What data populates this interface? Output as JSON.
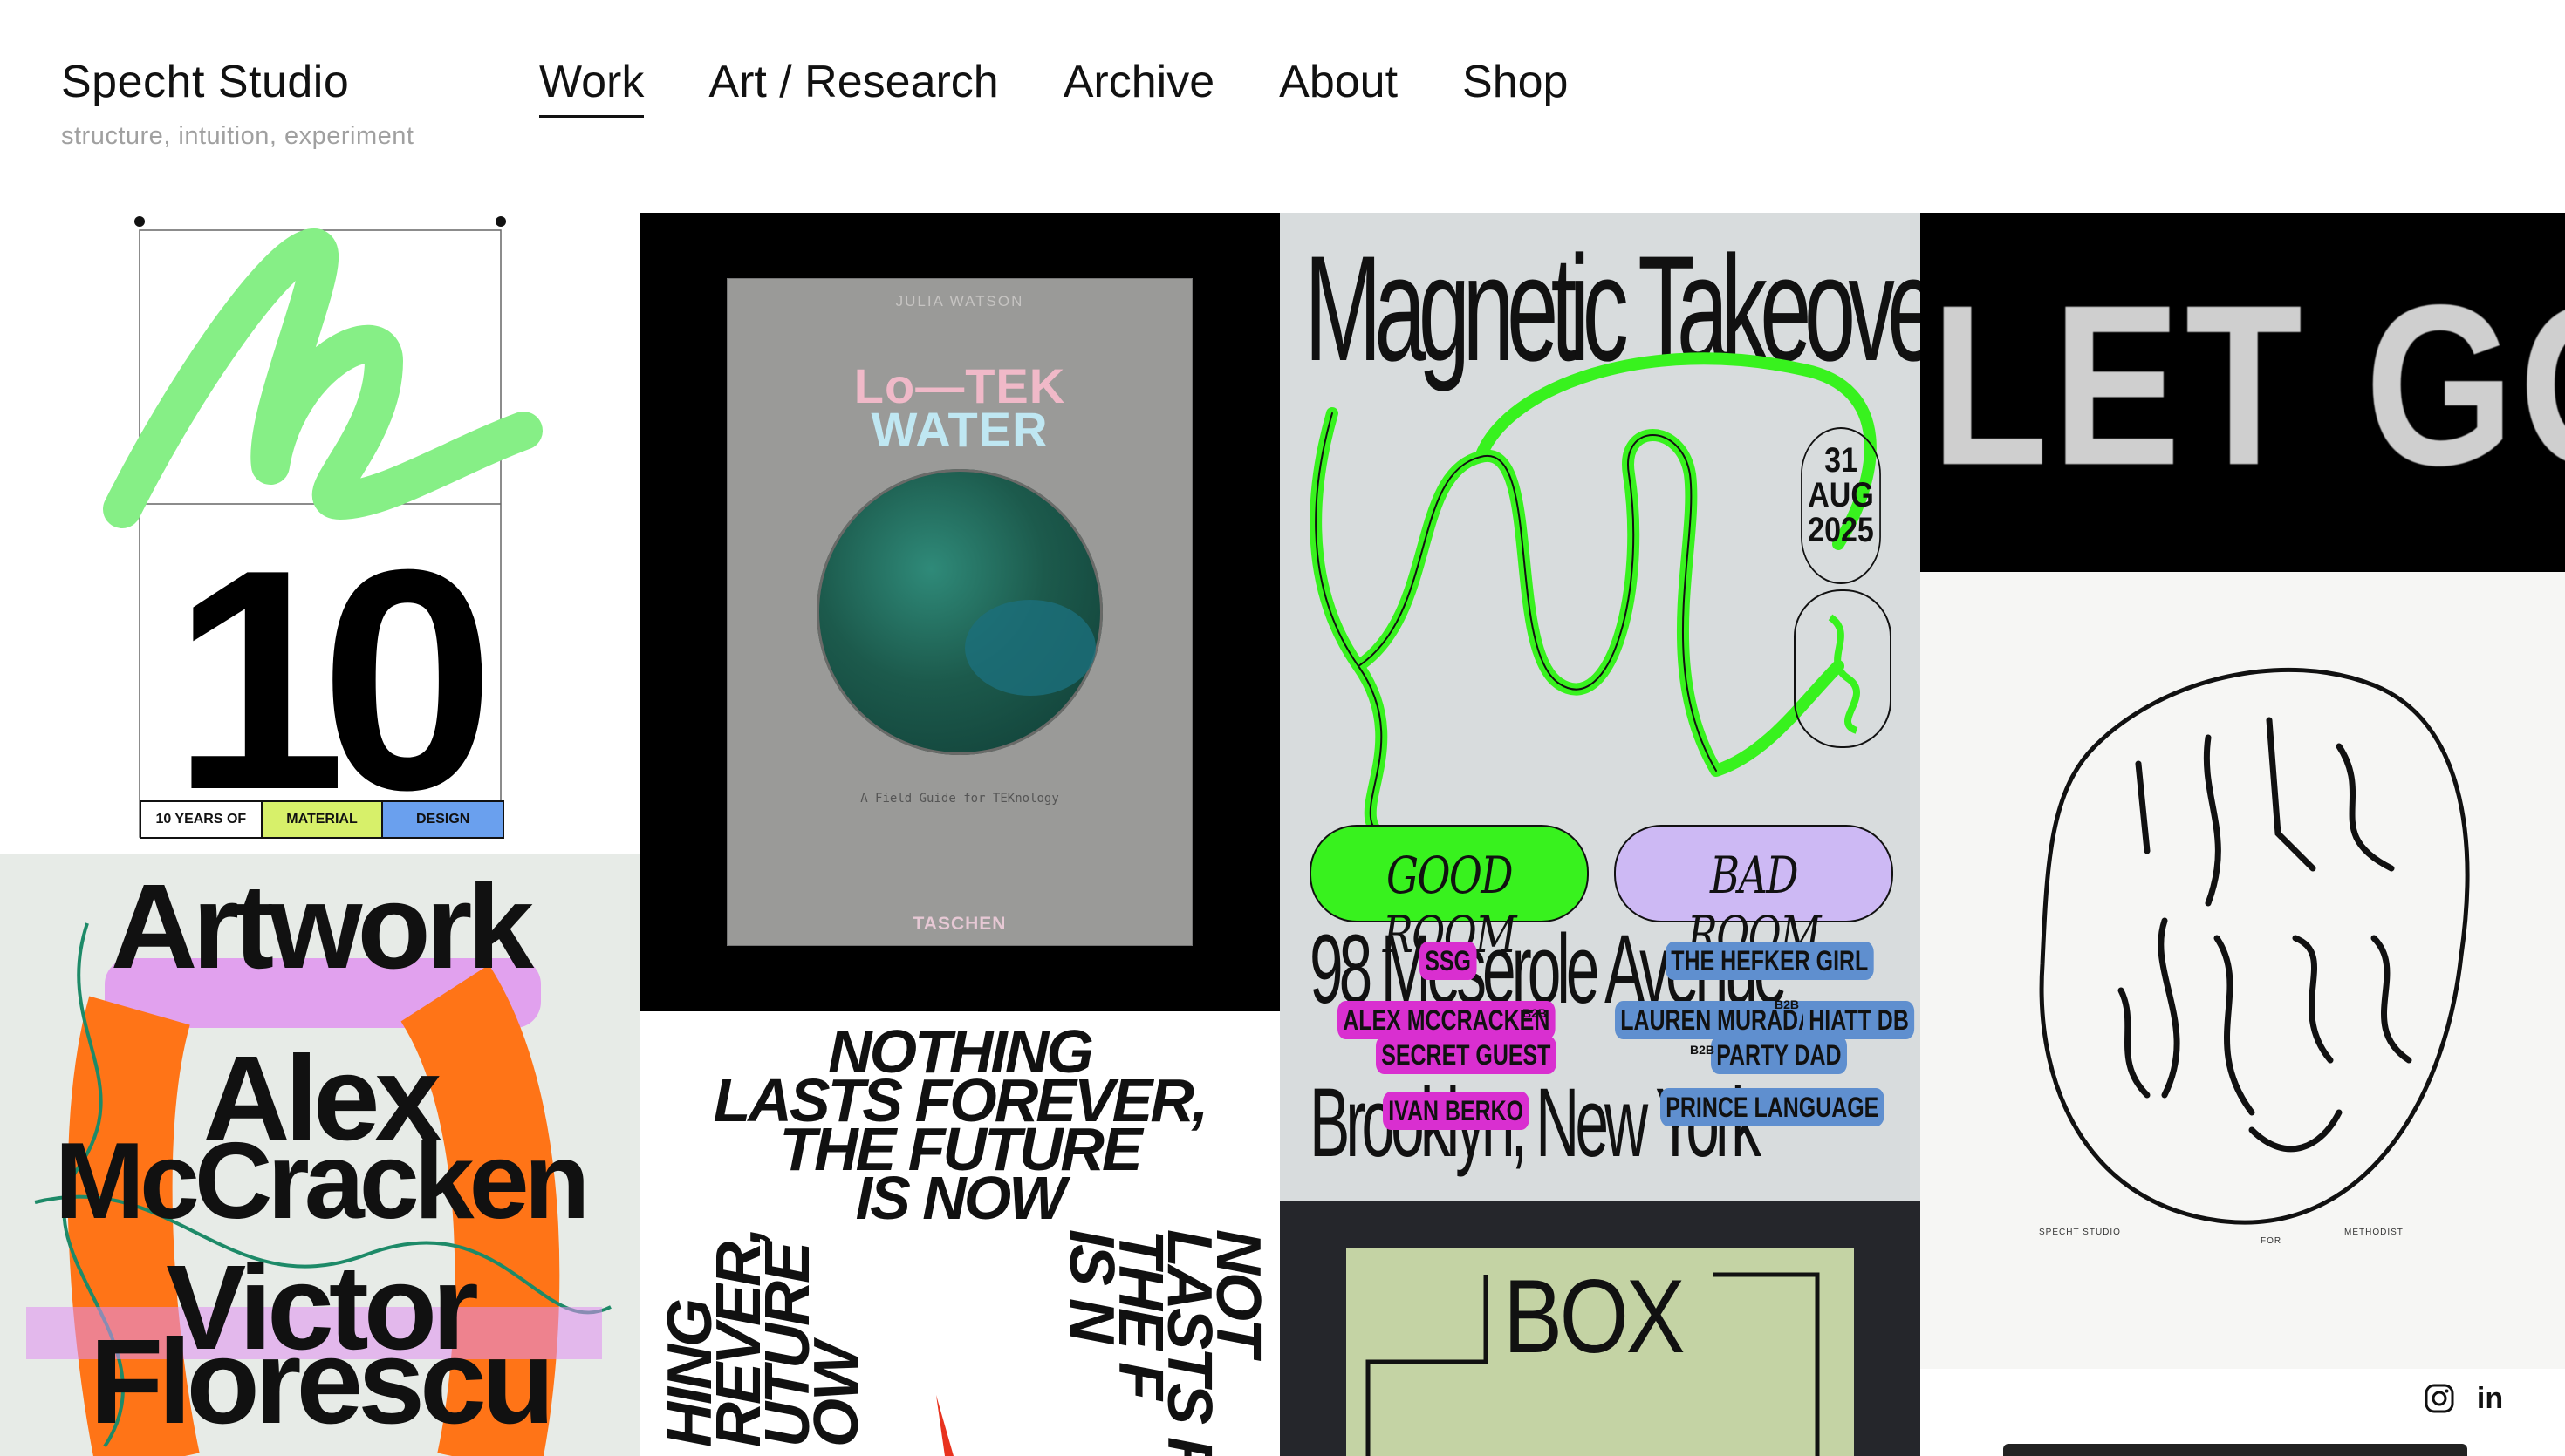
{
  "site": {
    "name": "Specht Studio",
    "tagline": "structure, intuition, experiment"
  },
  "nav": {
    "items": [
      {
        "label": "Work",
        "active": true
      },
      {
        "label": "Art / Research",
        "active": false
      },
      {
        "label": "Archive",
        "active": false
      },
      {
        "label": "About",
        "active": false
      },
      {
        "label": "Shop",
        "active": false
      }
    ]
  },
  "tiles": {
    "ten_years": {
      "number": "10",
      "strip": [
        "10 YEARS OF",
        "MATERIAL",
        "DESIGN"
      ],
      "strip_colors": [
        "#ffffff",
        "#d7f06a",
        "#6aa0ee"
      ],
      "accent": "#86ef86"
    },
    "artwork_poster": {
      "lines": [
        "Artwork",
        "Alex",
        "McCracken",
        "Victor",
        "Florescu"
      ],
      "accent": "#ff7417",
      "secondary": "#e08ef0"
    },
    "book": {
      "author": "JULIA WATSON",
      "title_line1": "Lo—TEK",
      "title_line2": "WATER",
      "subtitle": "A Field Guide for TEKnology",
      "publisher": "TASCHEN"
    },
    "nothing_lasts": {
      "headline_lines": [
        "NOTHING",
        "LASTS FOREVER,",
        "THE FUTURE",
        "IS NOW"
      ],
      "left_vertical": [
        "HING",
        "REVER,",
        "UTURE",
        "OW"
      ],
      "right_vertical": [
        "NOT",
        "LASTS F",
        "THE F",
        "IS N"
      ]
    },
    "magnetic_takeover": {
      "title": "Magnetic Takeover",
      "date_lines": [
        "31",
        "AUG",
        "2025"
      ],
      "good_room": "GOOD ROOM",
      "bad_room": "BAD ROOM",
      "address_line1": "98    Meserole   Avenue",
      "address_line2": "Brooklyn,      New     York",
      "lineup_pink": [
        "SSG",
        "ALEX MCCRACKEN",
        "SECRET GUEST",
        "IVAN BERKO"
      ],
      "lineup_blue": [
        "THE HEFKER GIRL",
        "LAUREN MURADA",
        "HIATT DB",
        "PARTY DAD",
        "PRINCE LANGUAGE"
      ],
      "b2b": "B2B",
      "accent": "#38f21e"
    },
    "box_book": {
      "word": "BOX"
    },
    "glitch": {
      "text": "LET GO"
    },
    "scribble": {
      "footer_left": "SPECHT  STUDIO",
      "footer_mid": "FOR",
      "footer_right": "METHODIST"
    }
  },
  "social": {
    "icons": [
      "instagram-icon",
      "linkedin-icon"
    ],
    "linkedin_glyph": "in"
  }
}
